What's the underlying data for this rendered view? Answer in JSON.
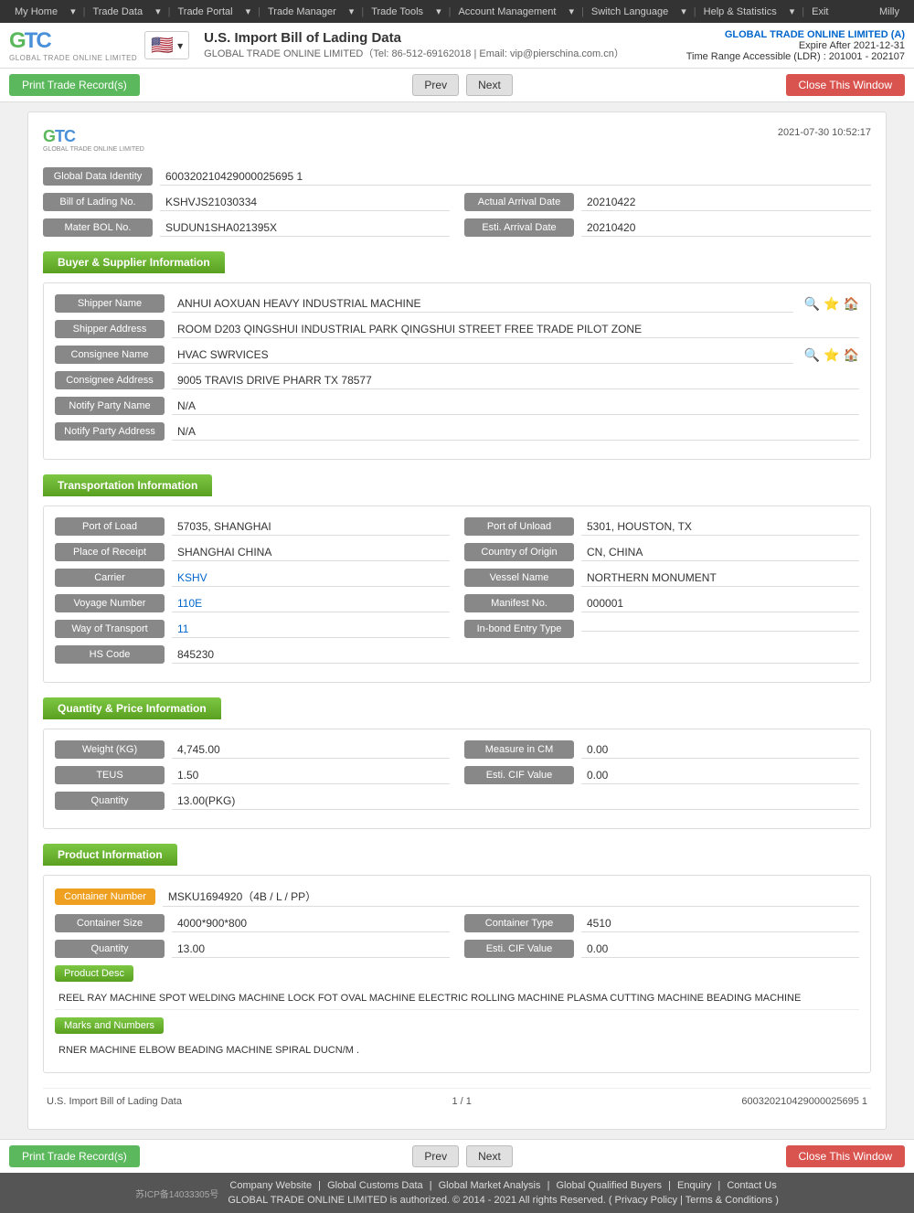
{
  "topnav": {
    "items": [
      {
        "label": "My Home",
        "id": "my-home"
      },
      {
        "label": "Trade Data",
        "id": "trade-data"
      },
      {
        "label": "Trade Portal",
        "id": "trade-portal"
      },
      {
        "label": "Trade Manager",
        "id": "trade-manager"
      },
      {
        "label": "Trade Tools",
        "id": "trade-tools"
      },
      {
        "label": "Account Management",
        "id": "account-management"
      },
      {
        "label": "Switch Language",
        "id": "switch-language"
      },
      {
        "label": "Help & Statistics",
        "id": "help-statistics"
      },
      {
        "label": "Exit",
        "id": "exit"
      }
    ],
    "user": "Milly"
  },
  "header": {
    "title": "U.S. Import Bill of Lading Data",
    "subtitle": "GLOBAL TRADE ONLINE LIMITED（Tel: 86-512-69162018 | Email: vip@pierschina.com.cn）",
    "company": "GLOBAL TRADE ONLINE LIMITED (A)",
    "expire": "Expire After 2021-12-31",
    "time_range": "Time Range Accessible (LDR) : 201001 - 202107"
  },
  "toolbar": {
    "print_label": "Print Trade Record(s)",
    "prev_label": "Prev",
    "next_label": "Next",
    "close_label": "Close This Window"
  },
  "record": {
    "datetime": "2021-07-30 10:52:17",
    "global_data_identity_label": "Global Data Identity",
    "global_data_identity": "600320210429000025695 1",
    "bill_of_lading_no_label": "Bill of Lading No.",
    "bill_of_lading_no": "KSHVJS21030334",
    "actual_arrival_date_label": "Actual Arrival Date",
    "actual_arrival_date": "20210422",
    "mater_bol_label": "Mater BOL No.",
    "mater_bol": "SUDUN1SHA021395X",
    "esti_arrival_label": "Esti. Arrival Date",
    "esti_arrival": "20210420"
  },
  "buyer_supplier": {
    "section_title": "Buyer & Supplier Information",
    "shipper_name_label": "Shipper Name",
    "shipper_name": "ANHUI AOXUAN HEAVY INDUSTRIAL MACHINE",
    "shipper_address_label": "Shipper Address",
    "shipper_address": "ROOM D203 QINGSHUI INDUSTRIAL PARK QINGSHUI STREET FREE TRADE PILOT ZONE",
    "consignee_name_label": "Consignee Name",
    "consignee_name": "HVAC SWRVICES",
    "consignee_address_label": "Consignee Address",
    "consignee_address": "9005 TRAVIS DRIVE PHARR TX 78577",
    "notify_party_name_label": "Notify Party Name",
    "notify_party_name": "N/A",
    "notify_party_address_label": "Notify Party Address",
    "notify_party_address": "N/A"
  },
  "transportation": {
    "section_title": "Transportation Information",
    "port_of_load_label": "Port of Load",
    "port_of_load": "57035, SHANGHAI",
    "port_of_unload_label": "Port of Unload",
    "port_of_unload": "5301, HOUSTON, TX",
    "place_of_receipt_label": "Place of Receipt",
    "place_of_receipt": "SHANGHAI CHINA",
    "country_of_origin_label": "Country of Origin",
    "country_of_origin": "CN, CHINA",
    "carrier_label": "Carrier",
    "carrier": "KSHV",
    "vessel_name_label": "Vessel Name",
    "vessel_name": "NORTHERN MONUMENT",
    "voyage_number_label": "Voyage Number",
    "voyage_number": "110E",
    "manifest_no_label": "Manifest No.",
    "manifest_no": "000001",
    "way_of_transport_label": "Way of Transport",
    "way_of_transport": "11",
    "inbond_entry_label": "In-bond Entry Type",
    "inbond_entry": "",
    "hs_code_label": "HS Code",
    "hs_code": "845230"
  },
  "quantity_price": {
    "section_title": "Quantity & Price Information",
    "weight_label": "Weight (KG)",
    "weight": "4,745.00",
    "measure_cm_label": "Measure in CM",
    "measure_cm": "0.00",
    "teus_label": "TEUS",
    "teus": "1.50",
    "esti_cif_label": "Esti. CIF Value",
    "esti_cif": "0.00",
    "quantity_label": "Quantity",
    "quantity": "13.00(PKG)"
  },
  "product_info": {
    "section_title": "Product Information",
    "container_number_label": "Container Number",
    "container_number": "MSKU1694920（4B / L / PP）",
    "container_size_label": "Container Size",
    "container_size": "4000*900*800",
    "container_type_label": "Container Type",
    "container_type": "4510",
    "quantity_label": "Quantity",
    "quantity": "13.00",
    "esti_cif_label": "Esti. CIF Value",
    "esti_cif": "0.00",
    "product_desc_btn": "Product Desc",
    "product_desc": "REEL RAY MACHINE SPOT WELDING MACHINE LOCK FOT OVAL MACHINE ELECTRIC ROLLING MACHINE PLASMA CUTTING MACHINE BEADING MACHINE",
    "marks_btn": "Marks and Numbers",
    "marks": "RNER MACHINE ELBOW BEADING MACHINE SPIRAL DUCN/M ."
  },
  "record_footer": {
    "source": "U.S. Import Bill of Lading Data",
    "page": "1 / 1",
    "id": "600320210429000025695 1"
  },
  "footer": {
    "icp": "苏ICP备14033305号",
    "links": [
      "Company Website",
      "Global Customs Data",
      "Global Market Analysis",
      "Global Qualified Buyers",
      "Enquiry",
      "Contact Us"
    ],
    "copyright": "GLOBAL TRADE ONLINE LIMITED is authorized. © 2014 - 2021 All rights Reserved.  ( Privacy Policy | Terms & Conditions )"
  }
}
